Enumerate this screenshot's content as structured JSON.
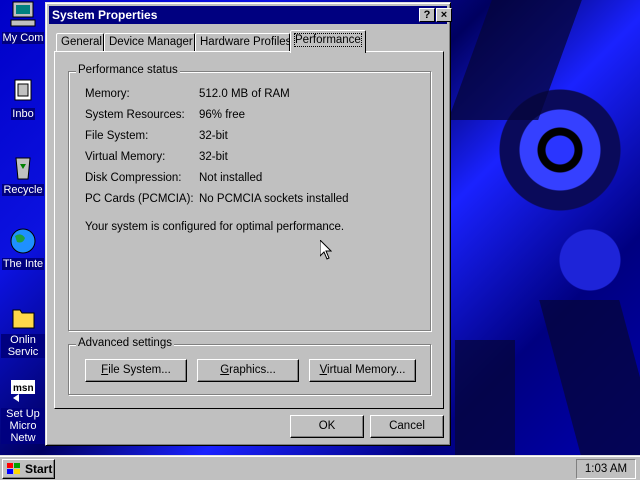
{
  "desktop": {
    "icons": [
      {
        "name": "my-computer",
        "label": "My Com"
      },
      {
        "name": "inbox",
        "label": "Inbo"
      },
      {
        "name": "recycle-bin",
        "label": "Recycle"
      },
      {
        "name": "the-internet",
        "label": "The Inte"
      },
      {
        "name": "online-services",
        "label": "Onlin Servic"
      },
      {
        "name": "setup-msn",
        "label": "Set Up Micro Netw"
      }
    ],
    "msn_text": "msn"
  },
  "window": {
    "title": "System Properties",
    "help_glyph": "?",
    "close_glyph": "×",
    "tabs": [
      "General",
      "Device Manager",
      "Hardware Profiles",
      "Performance"
    ],
    "active_tab": "Performance",
    "status": {
      "legend": "Performance status",
      "rows": [
        {
          "label": "Memory:",
          "value": "512.0 MB of RAM"
        },
        {
          "label": "System Resources:",
          "value": "96% free"
        },
        {
          "label": "File System:",
          "value": "32-bit"
        },
        {
          "label": "Virtual Memory:",
          "value": "32-bit"
        },
        {
          "label": "Disk Compression:",
          "value": "Not installed"
        },
        {
          "label": "PC Cards (PCMCIA):",
          "value": "No PCMCIA sockets installed"
        }
      ],
      "message": "Your system is configured for optimal performance."
    },
    "advanced": {
      "legend": "Advanced settings",
      "file_system_pre": "",
      "file_system_u": "F",
      "file_system_post": "ile System...",
      "graphics_pre": "",
      "graphics_u": "G",
      "graphics_post": "raphics...",
      "vm_pre": "",
      "vm_u": "V",
      "vm_post": "irtual Memory..."
    },
    "ok_label": "OK",
    "cancel_label": "Cancel"
  },
  "taskbar": {
    "start_label": "Start",
    "clock": "1:03 AM"
  }
}
